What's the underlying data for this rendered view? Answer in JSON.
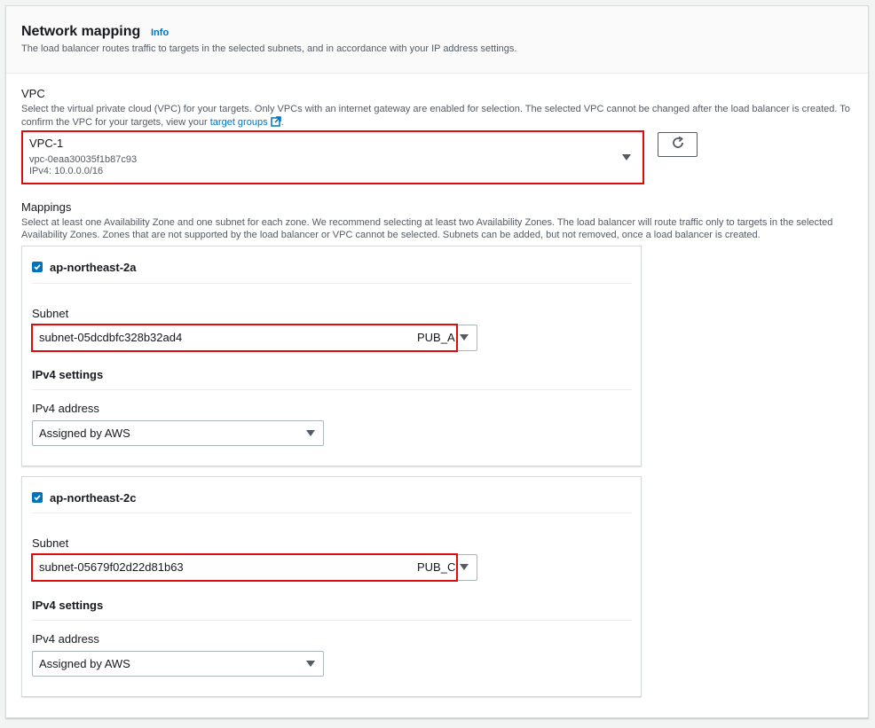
{
  "header": {
    "title": "Network mapping",
    "info_link": "Info",
    "description": "The load balancer routes traffic to targets in the selected subnets, and in accordance with your IP address settings."
  },
  "vpc": {
    "label": "VPC",
    "description_line1": "Select the virtual private cloud (VPC) for your targets. Only VPCs with an internet gateway are enabled for selection. The selected VPC cannot be changed after the load balancer is created. To",
    "description_line2_prefix": "confirm the VPC for your targets, view your",
    "description_link": "target groups",
    "description_suffix": ".",
    "selected_name": "VPC-1",
    "selected_id": "vpc-0eaa30035f1b87c93",
    "selected_cidr": "IPv4: 10.0.0.0/16"
  },
  "mappings": {
    "label": "Mappings",
    "description_line1": "Select at least one Availability Zone and one subnet for each zone. We recommend selecting at least two Availability Zones. The load balancer will route traffic only to targets in the selected",
    "description_line2": "Availability Zones. Zones that are not supported by the load balancer or VPC cannot be selected. Subnets can be added, but not removed, once a load balancer is created.",
    "zones": [
      {
        "name": "ap-northeast-2a",
        "checked": true,
        "subnet_label": "Subnet",
        "subnet_id": "subnet-05dcdbfc328b32ad4",
        "subnet_tag": "PUB_A",
        "ipv4_settings_label": "IPv4 settings",
        "ipv4_address_label": "IPv4 address",
        "ipv4_address_value": "Assigned by AWS"
      },
      {
        "name": "ap-northeast-2c",
        "checked": true,
        "subnet_label": "Subnet",
        "subnet_id": "subnet-05679f02d22d81b63",
        "subnet_tag": "PUB_C",
        "ipv4_settings_label": "IPv4 settings",
        "ipv4_address_label": "IPv4 address",
        "ipv4_address_value": "Assigned by AWS"
      }
    ]
  },
  "colors": {
    "highlight_border": "#e00b0b",
    "link": "#0073bb",
    "checkbox": "#0073bb"
  }
}
